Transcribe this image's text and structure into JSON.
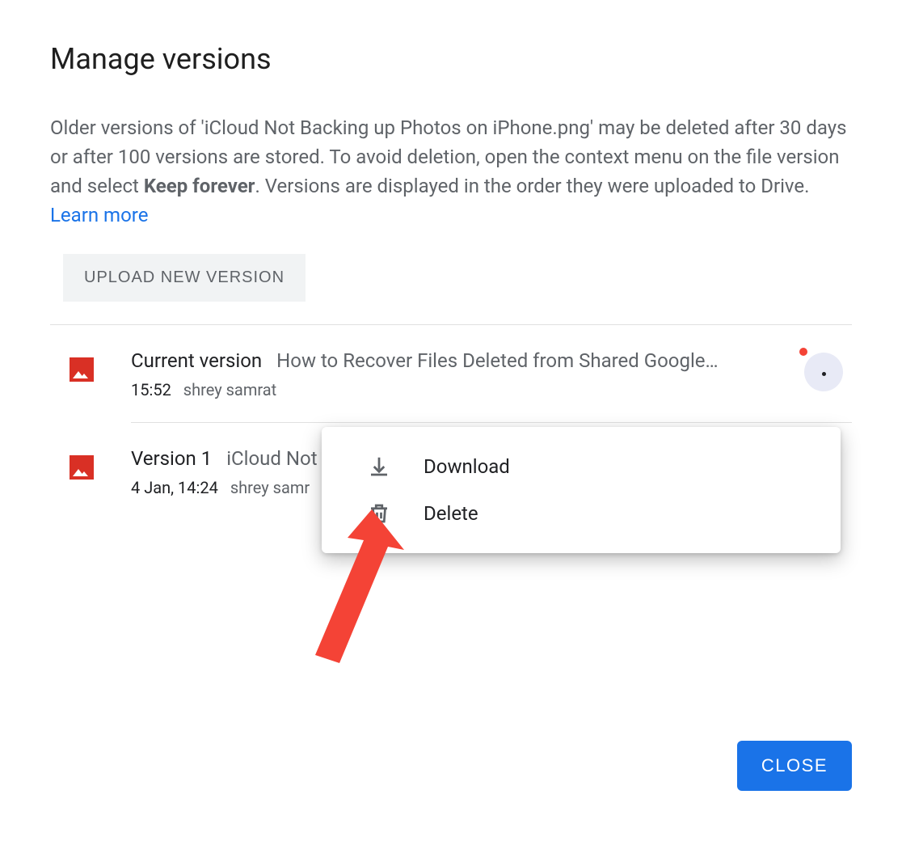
{
  "dialog": {
    "title": "Manage versions",
    "description_pre": "Older versions of 'iCloud Not Backing up Photos on iPhone.png' may be deleted after 30 days or after 100 versions are stored. To avoid deletion, open the context menu on the file version and select ",
    "description_bold": "Keep forever",
    "description_post": ". Versions are displayed in the order they were uploaded to Drive. ",
    "learn_more": "Learn more",
    "upload_button": "UPLOAD NEW VERSION",
    "close_button": "CLOSE"
  },
  "versions": [
    {
      "label": "Current version",
      "filename": "How to Recover Files Deleted from Shared Google…",
      "time": "15:52",
      "user": "shrey samrat",
      "has_menu_open": true
    },
    {
      "label": "Version 1",
      "filename": "iCloud Not",
      "time": "4 Jan, 14:24",
      "user": "shrey samr",
      "has_menu_open": false
    }
  ],
  "context_menu": {
    "download": "Download",
    "delete": "Delete"
  }
}
